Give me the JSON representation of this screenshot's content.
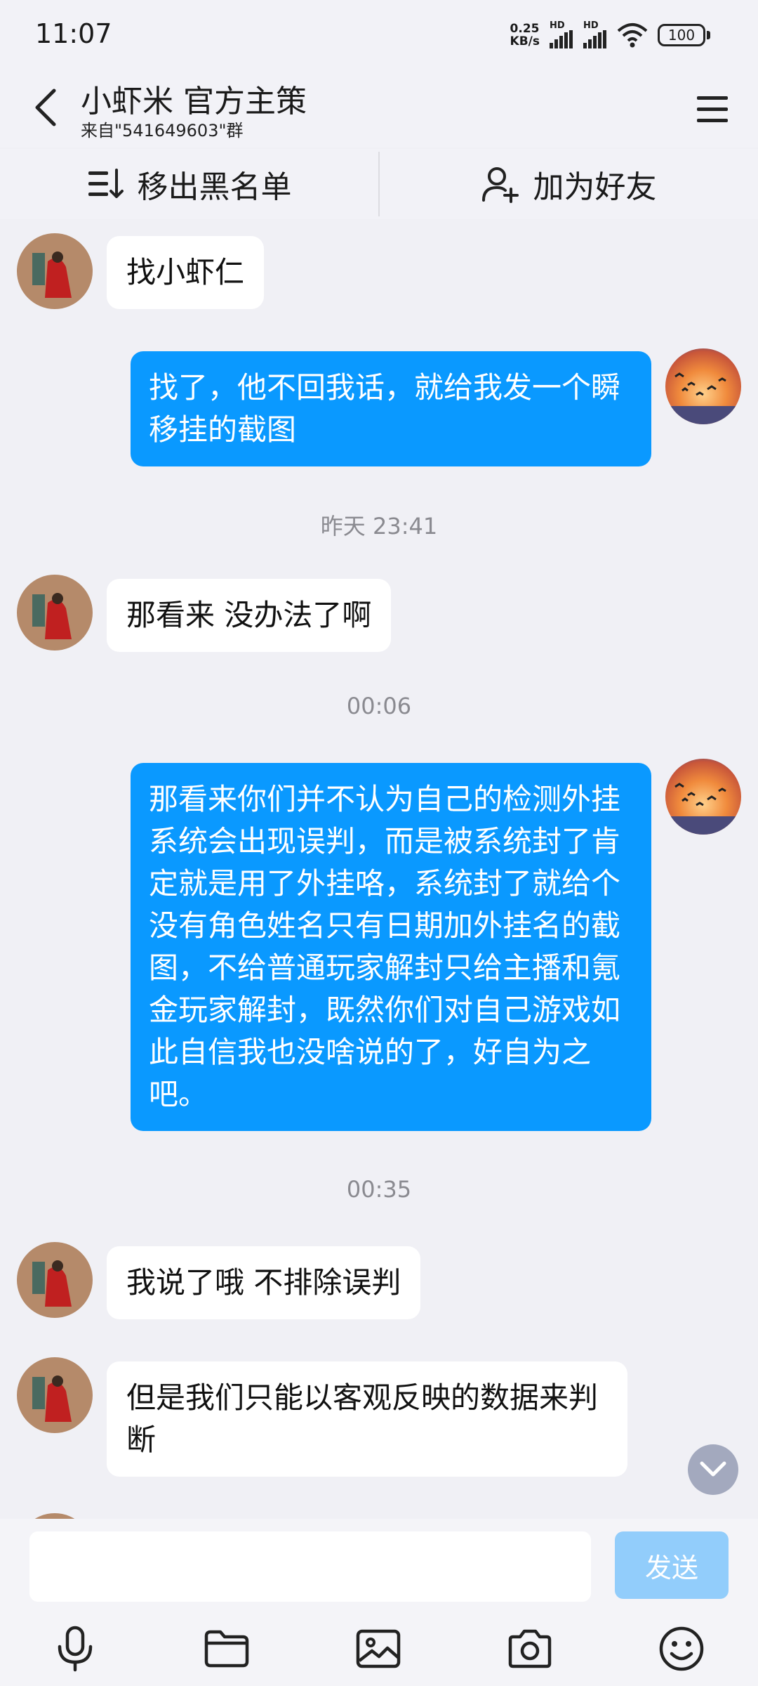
{
  "status": {
    "time": "11:07",
    "net_speed_value": "0.25",
    "net_speed_unit": "KB/s",
    "sim1_tag": "HD",
    "sim2_tag": "HD",
    "battery": "100"
  },
  "header": {
    "title": "小虾米 官方主策",
    "subtitle": "来自\"541649603\"群"
  },
  "actions": {
    "remove_blacklist": "移出黑名单",
    "add_friend": "加为好友"
  },
  "messages": [
    {
      "text": "找小虾仁"
    },
    {
      "text": "找了，他不回我话，就给我发一个瞬移挂的截图"
    },
    {
      "text": "昨天 23:41"
    },
    {
      "text": "那看来 没办法了啊"
    },
    {
      "text": "00:06"
    },
    {
      "text": "那看来你们并不认为自己的检测外挂系统会出现误判，而是被系统封了肯定就是用了外挂咯，系统封了就给个没有角色姓名只有日期加外挂名的截图，不给普通玩家解封只给主播和氪金玩家解封，既然你们对自己游戏如此自信我也没啥说的了，好自为之吧。"
    },
    {
      "text": "00:35"
    },
    {
      "text": "我说了哦 不排除误判"
    },
    {
      "text": "但是我们只能以客观反映的数据来判断"
    }
  ],
  "input": {
    "placeholder": "",
    "send_label": "发送"
  },
  "icons": {
    "back": "chevron-left-icon",
    "menu": "hamburger-menu-icon",
    "remove_blacklist": "list-sort-icon",
    "add_friend": "add-user-icon",
    "scroll": "chevron-down-icon",
    "toolbar": [
      "microphone-icon",
      "folder-icon",
      "image-icon",
      "camera-icon",
      "emoji-icon"
    ]
  },
  "colors": {
    "outgoing_bubble": "#0a99ff",
    "incoming_bubble": "#ffffff",
    "background": "#f0f0f5",
    "send_button": "#92cdfb"
  }
}
